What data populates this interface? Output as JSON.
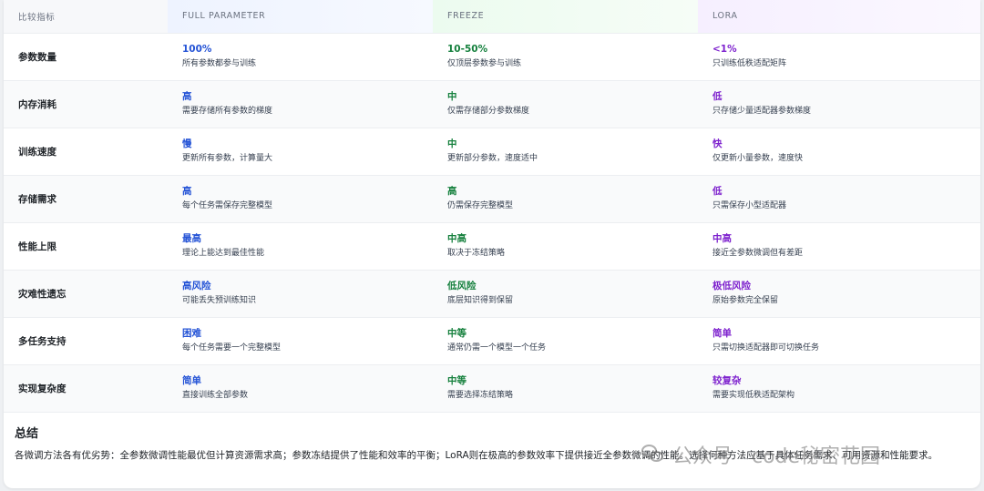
{
  "table": {
    "headers": [
      "比较指标",
      "FULL PARAMETER",
      "FREEZE",
      "LORA"
    ],
    "rows": [
      {
        "metric": "参数数量",
        "full": {
          "value": "100%",
          "desc": "所有参数都参与训练"
        },
        "freeze": {
          "value": "10-50%",
          "desc": "仅顶层参数参与训练"
        },
        "lora": {
          "value": "<1%",
          "desc": "只训练低秩适配矩阵"
        }
      },
      {
        "metric": "内存消耗",
        "full": {
          "value": "高",
          "desc": "需要存储所有参数的梯度"
        },
        "freeze": {
          "value": "中",
          "desc": "仅需存储部分参数梯度"
        },
        "lora": {
          "value": "低",
          "desc": "只存储少量适配器参数梯度"
        }
      },
      {
        "metric": "训练速度",
        "full": {
          "value": "慢",
          "desc": "更新所有参数，计算量大"
        },
        "freeze": {
          "value": "中",
          "desc": "更新部分参数，速度适中"
        },
        "lora": {
          "value": "快",
          "desc": "仅更新小量参数，速度快"
        }
      },
      {
        "metric": "存储需求",
        "full": {
          "value": "高",
          "desc": "每个任务需保存完整模型"
        },
        "freeze": {
          "value": "高",
          "desc": "仍需保存完整模型"
        },
        "lora": {
          "value": "低",
          "desc": "只需保存小型适配器"
        }
      },
      {
        "metric": "性能上限",
        "full": {
          "value": "最高",
          "desc": "理论上能达到最佳性能"
        },
        "freeze": {
          "value": "中高",
          "desc": "取决于冻结策略"
        },
        "lora": {
          "value": "中高",
          "desc": "接近全参数微调但有差距"
        }
      },
      {
        "metric": "灾难性遗忘",
        "full": {
          "value": "高风险",
          "desc": "可能丢失预训练知识"
        },
        "freeze": {
          "value": "低风险",
          "desc": "底层知识得到保留"
        },
        "lora": {
          "value": "极低风险",
          "desc": "原始参数完全保留"
        }
      },
      {
        "metric": "多任务支持",
        "full": {
          "value": "困难",
          "desc": "每个任务需要一个完整模型"
        },
        "freeze": {
          "value": "中等",
          "desc": "通常仍需一个模型一个任务"
        },
        "lora": {
          "value": "简单",
          "desc": "只需切换适配器即可切换任务"
        }
      },
      {
        "metric": "实现复杂度",
        "full": {
          "value": "简单",
          "desc": "直接训练全部参数"
        },
        "freeze": {
          "value": "中等",
          "desc": "需要选择冻结策略"
        },
        "lora": {
          "value": "较复杂",
          "desc": "需要实现低秩适配架构"
        }
      }
    ]
  },
  "summary": {
    "title": "总结",
    "text": "各微调方法各有优劣势：全参数微调性能最优但计算资源需求高；参数冻结提供了性能和效率的平衡；LoRA则在极高的参数效率下提供接近全参数微调的性能。选择何种方法应基于具体任务需求、可用资源和性能要求。"
  },
  "watermark": {
    "text": "公众号 · code秘密花园"
  },
  "colors": {
    "full": "#2453d6",
    "freeze": "#15803d",
    "lora": "#7e22ce"
  }
}
